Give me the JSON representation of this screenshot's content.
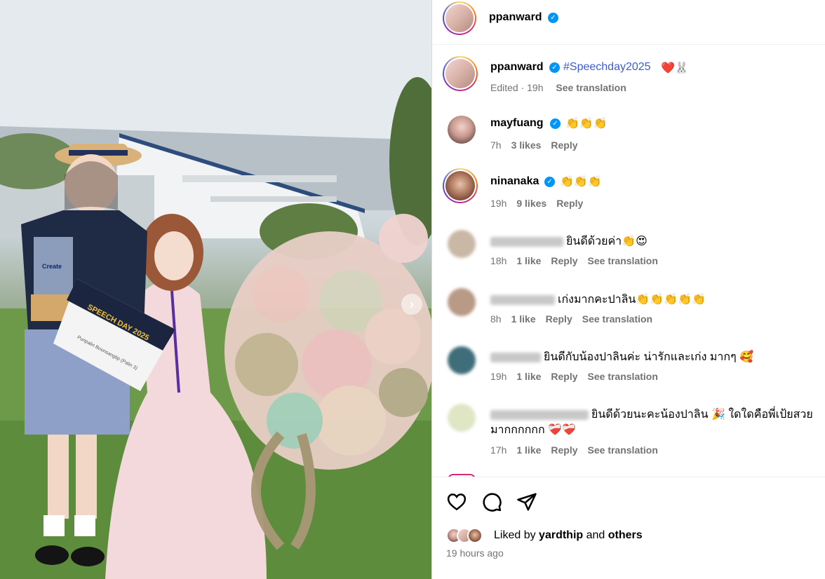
{
  "post": {
    "author": "ppanward",
    "caption_user": "ppanward",
    "caption_hashtag": "#Speechday2025",
    "caption_emoji": "❤️🐰",
    "caption_meta": {
      "edited": "Edited · 19h",
      "translate": "See translation"
    },
    "photo_text": {
      "trophy": "Create",
      "certificate_title": "SPEECH DAY 2025",
      "certificate_name": "Punpalin Boonsangtip (Palin 3)"
    }
  },
  "comments": [
    {
      "user": "mayfuang",
      "verified": true,
      "text": "👏👏👏",
      "time": "7h",
      "likes": "3 likes",
      "reply": "Reply"
    },
    {
      "user": "ninanaka",
      "verified": true,
      "text": "👏👏👏",
      "time": "19h",
      "likes": "9 likes",
      "reply": "Reply"
    },
    {
      "user": "",
      "text": "ยินดีด้วยค่า👏😍",
      "time": "18h",
      "likes": "1 like",
      "reply": "Reply",
      "translate": "See translation"
    },
    {
      "user": "",
      "text": "เก่งมากคะปาลิน👏👏👏👏👏",
      "time": "8h",
      "likes": "1 like",
      "reply": "Reply",
      "translate": "See translation"
    },
    {
      "user": "",
      "text": "ยินดีกับน้องปาลินค่ะ น่ารักและเก่ง มากๆ 🥰",
      "time": "19h",
      "likes": "1 like",
      "reply": "Reply",
      "translate": "See translation"
    },
    {
      "user": "",
      "text_line1": "ยินดีด้วยนะคะน้องปาลิน 🎉 ใดใดคือพี่เป้ยสวย",
      "text_line2": "มากกกกกก ❤️‍🩹❤️‍🩹",
      "time": "17h",
      "likes": "1 like",
      "reply": "Reply",
      "translate": "See translation"
    }
  ],
  "footer": {
    "liked_prefix": "Liked by",
    "liked_user": "yardthip",
    "liked_and": "and",
    "liked_others": "others",
    "time_ago": "19 hours ago"
  },
  "colors": {
    "accent": "#0095f6",
    "meta": "#737373",
    "hashtag": "#3b5bdb"
  }
}
